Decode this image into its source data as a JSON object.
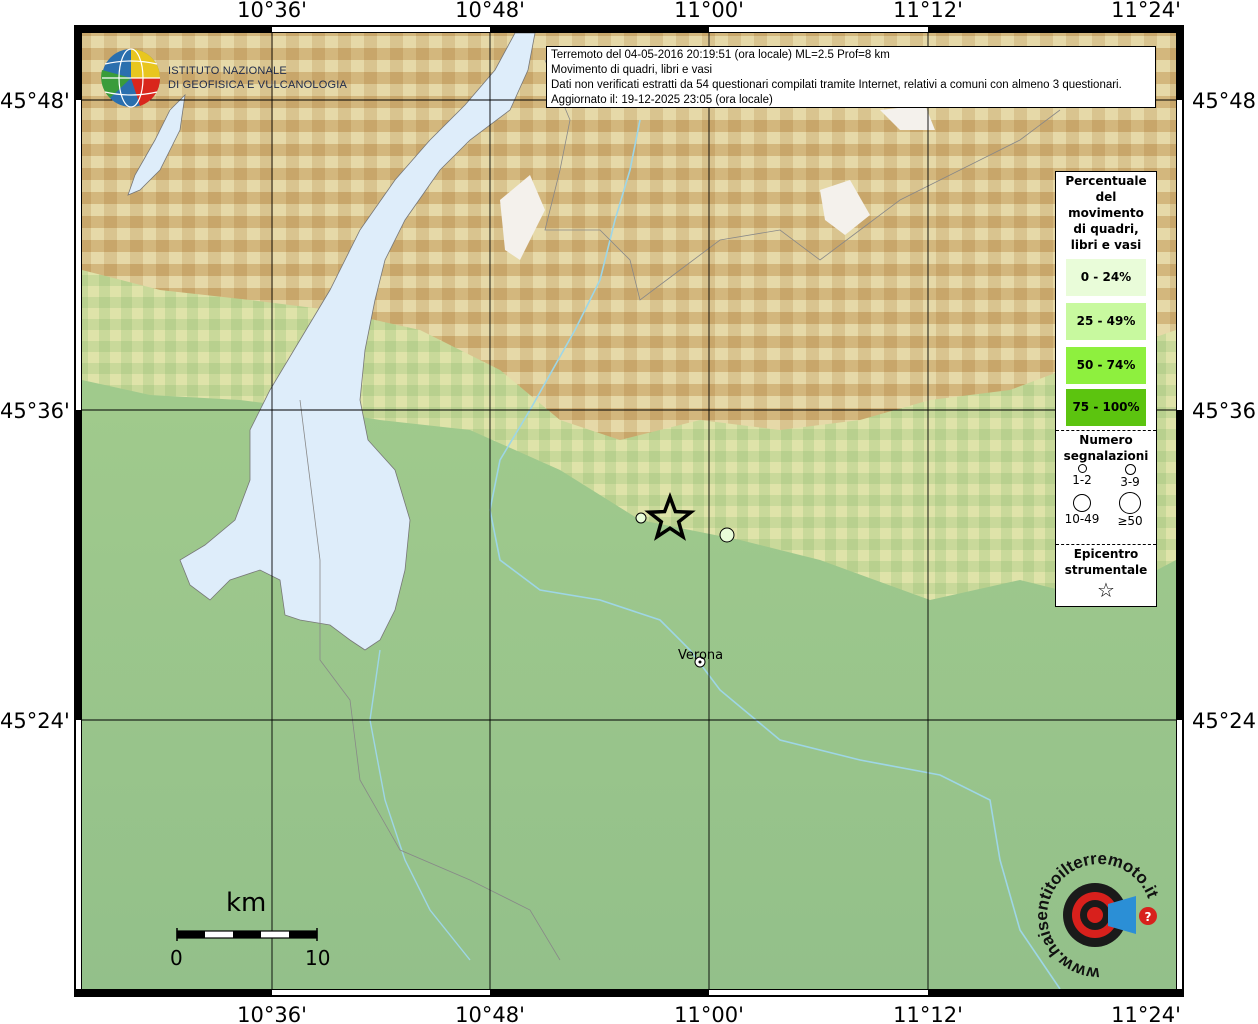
{
  "axes": {
    "lon_ticks": [
      "10°36'",
      "10°48'",
      "11°00'",
      "11°12'",
      "11°24'"
    ],
    "lat_ticks": [
      "45°48'",
      "45°36'",
      "45°24'"
    ]
  },
  "logo": {
    "line1": "ISTITUTO NAZIONALE",
    "line2": "DI GEOFISICA E VULCANOLOGIA"
  },
  "info": {
    "line1": "Terremoto del 04-05-2016 20:19:51 (ora locale) ML=2.5 Prof=8 km",
    "line2": "Movimento di quadri, libri e vasi",
    "line3": "Dati non verificati estratti da 54 questionari compilati tramite Internet, relativi a comuni con almeno 3 questionari.",
    "line4": "Aggiornato il: 19-12-2025 23:05 (ora locale)"
  },
  "legend": {
    "title": [
      "Percentuale",
      "del",
      "movimento",
      "di quadri,",
      "libri e vasi"
    ],
    "classes": [
      {
        "label": "0 - 24%",
        "color": "#e9fcd9"
      },
      {
        "label": "25 - 49%",
        "color": "#c8f99f"
      },
      {
        "label": "50 - 74%",
        "color": "#8ef03e"
      },
      {
        "label": "75 - 100%",
        "color": "#5cc40f"
      }
    ],
    "count_title": [
      "Numero",
      "segnalazioni"
    ],
    "counts": [
      "1-2",
      "3-9",
      "10-49",
      "≥50"
    ],
    "epicenter_title": [
      "Epicentro",
      "strumentale"
    ]
  },
  "places": {
    "city": "Verona"
  },
  "scale": {
    "unit": "km",
    "start": "0",
    "end": "10"
  },
  "badge": {
    "text": "www.haisentitoilterremoto.it",
    "color_red": "#d8201c"
  }
}
